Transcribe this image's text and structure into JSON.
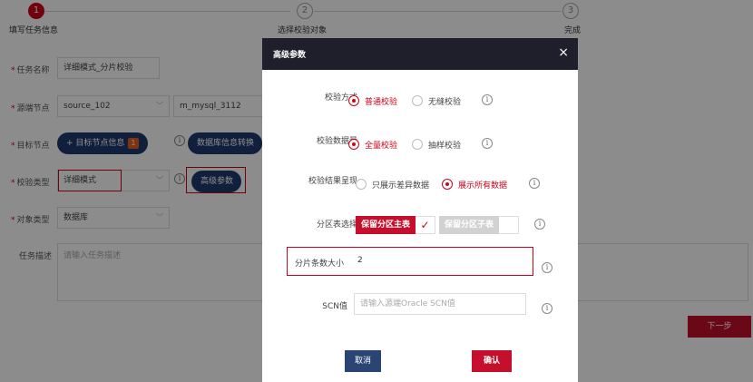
{
  "steps": [
    {
      "number": "1",
      "label": "填写任务信息"
    },
    {
      "number": "2",
      "label": "选择校验对象"
    },
    {
      "number": "3",
      "label": "完成"
    }
  ],
  "form": {
    "task_name": {
      "label": "任务名称",
      "value": "详细模式_分片校验"
    },
    "source_node": {
      "label": "源端节点",
      "value": "source_102",
      "db_value": "m_mysql_3112"
    },
    "target_node": {
      "label": "目标节点",
      "button": "+ 目标节点信息",
      "badge": "1",
      "convert_button": "数据库信息转换"
    },
    "check_type": {
      "label": "校验类型",
      "value": "详细模式",
      "advanced_button": "高级参数"
    },
    "object_type": {
      "label": "对象类型",
      "value": "数据库"
    },
    "task_desc": {
      "label": "任务描述",
      "placeholder": "请输入任务描述"
    },
    "next_button": "下一步"
  },
  "modal": {
    "title": "高级参数",
    "close": "×",
    "check_method": {
      "label": "校验方式",
      "options": [
        "普通校验",
        "无缝校验"
      ],
      "selected": 0
    },
    "check_amount": {
      "label": "校验数据量",
      "options": [
        "全量校验",
        "抽样校验"
      ],
      "selected": 0
    },
    "result_display": {
      "label": "校验结果呈现",
      "options": [
        "只展示差异数据",
        "展示所有数据"
      ],
      "selected": 1
    },
    "partition": {
      "label": "分区表选择",
      "keep_main": "保留分区主表",
      "keep_sub": "保留分区子表"
    },
    "shard_size": {
      "label": "分片条数大小",
      "value": "2"
    },
    "scn": {
      "label": "SCN值",
      "placeholder": "请输入源端Oracle SCN值"
    },
    "cancel": "取消",
    "confirm": "确认"
  },
  "colors": {
    "accent_red": "#d0021b",
    "navy": "#1e3a6e",
    "modal_header": "#1e1f2a"
  },
  "icons": {
    "info": "info-circle-icon",
    "close": "close-icon",
    "check": "checkmark-icon"
  }
}
